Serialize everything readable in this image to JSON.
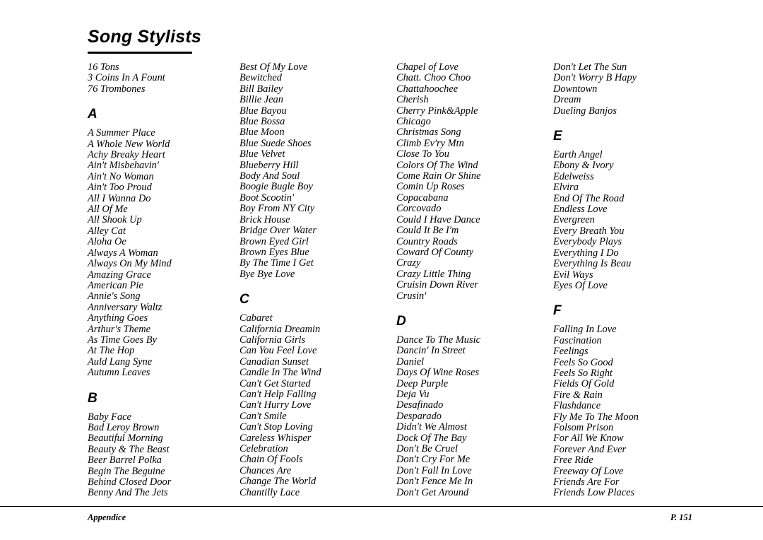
{
  "page": {
    "title": "Song Stylists",
    "footer_left": "Appendice",
    "footer_right": "P. 151"
  },
  "columns": [
    {
      "blocks": [
        {
          "letter": null,
          "entries": [
            "16 Tons",
            "3 Coins In A Fount",
            "76 Trombones"
          ]
        },
        {
          "letter": "A",
          "entries": [
            "A Summer Place",
            "A Whole New World",
            "Achy Breaky Heart",
            "Ain't Misbehavin'",
            "Ain't No Woman",
            "Ain't Too Proud",
            "All I Wanna Do",
            "All Of Me",
            "All Shook Up",
            "Alley Cat",
            "Aloha Oe",
            "Always A Woman",
            "Always On My Mind",
            "Amazing Grace",
            "American Pie",
            "Annie's Song",
            "Anniversary Waltz",
            "Anything Goes",
            "Arthur's Theme",
            "As Time Goes By",
            "At The Hop",
            "Auld Lang Syne",
            "Autumn Leaves"
          ]
        },
        {
          "letter": "B",
          "entries": [
            "Baby Face",
            "Bad Leroy Brown",
            "Beautiful Morning",
            "Beauty & The Beast",
            "Beer Barrel Polka",
            "Begin The Beguine",
            "Behind Closed Door",
            "Benny And The Jets"
          ]
        }
      ]
    },
    {
      "blocks": [
        {
          "letter": null,
          "entries": [
            "Best Of My Love",
            "Bewitched",
            "Bill Bailey",
            "Billie Jean",
            "Blue Bayou",
            "Blue Bossa",
            "Blue Moon",
            "Blue Suede Shoes",
            "Blue Velvet",
            "Blueberry Hill",
            "Body And Soul",
            "Boogie Bugle Boy",
            "Boot Scootin'",
            "Boy From NY City",
            "Brick House",
            "Bridge Over Water",
            "Brown Eyed Girl",
            "Brown Eyes Blue",
            "By The Time I Get",
            "Bye Bye Love"
          ]
        },
        {
          "letter": "C",
          "entries": [
            "Cabaret",
            "California Dreamin",
            "California Girls",
            "Can You Feel Love",
            "Canadian Sunset",
            "Candle In The Wind",
            "Can't Get Started",
            "Can't Help Falling",
            "Can't Hurry Love",
            "Can't Smile",
            "Can't Stop Loving",
            "Careless Whisper",
            "Celebration",
            "Chain Of Fools",
            "Chances Are",
            "Change The World",
            "Chantilly Lace"
          ]
        }
      ]
    },
    {
      "blocks": [
        {
          "letter": null,
          "entries": [
            "Chapel of Love",
            "Chatt. Choo Choo",
            "Chattahoochee",
            "Cherish",
            "Cherry Pink&Apple",
            "Chicago",
            "Christmas Song",
            "Climb Ev'ry Mtn",
            "Close To You",
            "Colors Of The Wind",
            "Come Rain Or Shine",
            "Comin Up Roses",
            "Copacabana",
            "Corcovado",
            "Could I Have Dance",
            "Could It Be I'm",
            "Country Roads",
            "Coward Of County",
            "Crazy",
            "Crazy Little Thing",
            "Cruisin Down River",
            "Crusin'"
          ]
        },
        {
          "letter": "D",
          "entries": [
            "Dance To The Music",
            "Dancin' In Street",
            "Daniel",
            "Days Of Wine Roses",
            "Deep Purple",
            "Deja Vu",
            "Desafinado",
            "Desparado",
            "Didn't We Almost",
            "Dock Of The Bay",
            "Don't Be Cruel",
            "Don't Cry For Me",
            "Don't Fall In Love",
            "Don't Fence Me In",
            "Don't Get Around"
          ]
        }
      ]
    },
    {
      "blocks": [
        {
          "letter": null,
          "entries": [
            "Don't Let The Sun",
            "Don't Worry B Hapy",
            "Downtown",
            "Dream",
            "Dueling Banjos"
          ]
        },
        {
          "letter": "E",
          "entries": [
            "Earth Angel",
            "Ebony & Ivory",
            "Edelweiss",
            "Elvira",
            "End Of The Road",
            "Endless Love",
            "Evergreen",
            "Every Breath You",
            "Everybody Plays",
            "Everything I Do",
            "Everything Is Beau",
            "Evil Ways",
            "Eyes Of Love"
          ]
        },
        {
          "letter": "F",
          "entries": [
            "Falling In Love",
            "Fascination",
            "Feelings",
            "Feels So Good",
            "Feels So Right",
            "Fields Of Gold",
            "Fire & Rain",
            "Flashdance",
            "Fly Me To The Moon",
            "Folsom Prison",
            "For All We Know",
            "Forever And Ever",
            "Free Ride",
            "Freeway Of Love",
            "Friends Are For",
            "Friends Low Places"
          ]
        }
      ]
    }
  ]
}
